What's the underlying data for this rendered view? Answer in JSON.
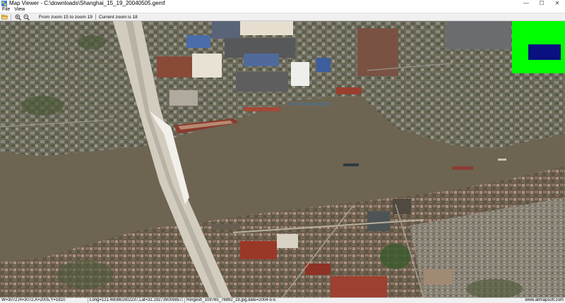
{
  "window": {
    "title": "Map Viewer - C:\\downloads\\Shanghai_15_19_20040505.gemf",
    "minimize_glyph": "—",
    "maximize_glyph": "☐",
    "close_glyph": "✕"
  },
  "menu": {
    "items": [
      "File",
      "View"
    ]
  },
  "toolbar": {
    "icons": [
      "open-folder-icon",
      "zoom-in-icon",
      "zoom-out-icon"
    ],
    "zoom_range": "From zoom 15 to zoom 19",
    "current_zoom": "Current zoom is 18"
  },
  "map": {
    "minimap": {
      "background": "#00ff00",
      "viewport_color": "#0a1080"
    }
  },
  "status": {
    "dims": "W=3072,H=3072,X=2005,Y=1810",
    "coords": "Long=121.480861902237,Lat=31.1927390098572",
    "tile": "Re\\gesh_109765_76892_18.jpg,date=2004-5-5",
    "credit": "www.allmapsoft.com"
  }
}
